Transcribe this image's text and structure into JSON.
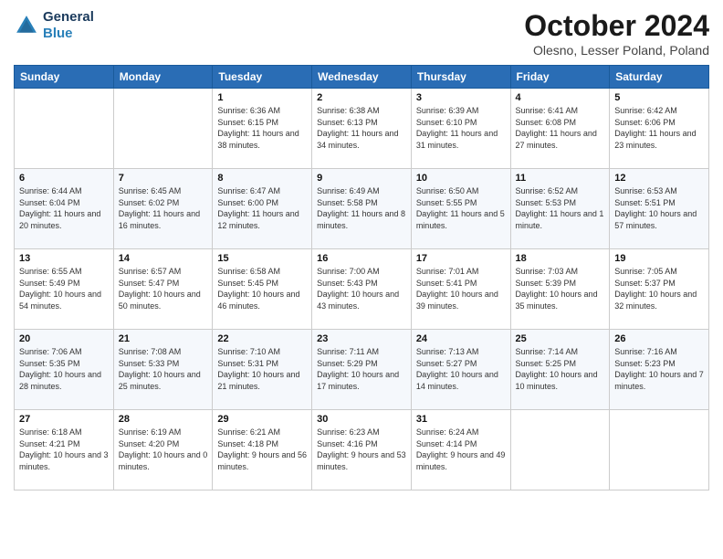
{
  "header": {
    "logo_line1": "General",
    "logo_line2": "Blue",
    "month_title": "October 2024",
    "location": "Olesno, Lesser Poland, Poland"
  },
  "days_of_week": [
    "Sunday",
    "Monday",
    "Tuesday",
    "Wednesday",
    "Thursday",
    "Friday",
    "Saturday"
  ],
  "weeks": [
    [
      {
        "day": "",
        "sunrise": "",
        "sunset": "",
        "daylight": ""
      },
      {
        "day": "",
        "sunrise": "",
        "sunset": "",
        "daylight": ""
      },
      {
        "day": "1",
        "sunrise": "Sunrise: 6:36 AM",
        "sunset": "Sunset: 6:15 PM",
        "daylight": "Daylight: 11 hours and 38 minutes."
      },
      {
        "day": "2",
        "sunrise": "Sunrise: 6:38 AM",
        "sunset": "Sunset: 6:13 PM",
        "daylight": "Daylight: 11 hours and 34 minutes."
      },
      {
        "day": "3",
        "sunrise": "Sunrise: 6:39 AM",
        "sunset": "Sunset: 6:10 PM",
        "daylight": "Daylight: 11 hours and 31 minutes."
      },
      {
        "day": "4",
        "sunrise": "Sunrise: 6:41 AM",
        "sunset": "Sunset: 6:08 PM",
        "daylight": "Daylight: 11 hours and 27 minutes."
      },
      {
        "day": "5",
        "sunrise": "Sunrise: 6:42 AM",
        "sunset": "Sunset: 6:06 PM",
        "daylight": "Daylight: 11 hours and 23 minutes."
      }
    ],
    [
      {
        "day": "6",
        "sunrise": "Sunrise: 6:44 AM",
        "sunset": "Sunset: 6:04 PM",
        "daylight": "Daylight: 11 hours and 20 minutes."
      },
      {
        "day": "7",
        "sunrise": "Sunrise: 6:45 AM",
        "sunset": "Sunset: 6:02 PM",
        "daylight": "Daylight: 11 hours and 16 minutes."
      },
      {
        "day": "8",
        "sunrise": "Sunrise: 6:47 AM",
        "sunset": "Sunset: 6:00 PM",
        "daylight": "Daylight: 11 hours and 12 minutes."
      },
      {
        "day": "9",
        "sunrise": "Sunrise: 6:49 AM",
        "sunset": "Sunset: 5:58 PM",
        "daylight": "Daylight: 11 hours and 8 minutes."
      },
      {
        "day": "10",
        "sunrise": "Sunrise: 6:50 AM",
        "sunset": "Sunset: 5:55 PM",
        "daylight": "Daylight: 11 hours and 5 minutes."
      },
      {
        "day": "11",
        "sunrise": "Sunrise: 6:52 AM",
        "sunset": "Sunset: 5:53 PM",
        "daylight": "Daylight: 11 hours and 1 minute."
      },
      {
        "day": "12",
        "sunrise": "Sunrise: 6:53 AM",
        "sunset": "Sunset: 5:51 PM",
        "daylight": "Daylight: 10 hours and 57 minutes."
      }
    ],
    [
      {
        "day": "13",
        "sunrise": "Sunrise: 6:55 AM",
        "sunset": "Sunset: 5:49 PM",
        "daylight": "Daylight: 10 hours and 54 minutes."
      },
      {
        "day": "14",
        "sunrise": "Sunrise: 6:57 AM",
        "sunset": "Sunset: 5:47 PM",
        "daylight": "Daylight: 10 hours and 50 minutes."
      },
      {
        "day": "15",
        "sunrise": "Sunrise: 6:58 AM",
        "sunset": "Sunset: 5:45 PM",
        "daylight": "Daylight: 10 hours and 46 minutes."
      },
      {
        "day": "16",
        "sunrise": "Sunrise: 7:00 AM",
        "sunset": "Sunset: 5:43 PM",
        "daylight": "Daylight: 10 hours and 43 minutes."
      },
      {
        "day": "17",
        "sunrise": "Sunrise: 7:01 AM",
        "sunset": "Sunset: 5:41 PM",
        "daylight": "Daylight: 10 hours and 39 minutes."
      },
      {
        "day": "18",
        "sunrise": "Sunrise: 7:03 AM",
        "sunset": "Sunset: 5:39 PM",
        "daylight": "Daylight: 10 hours and 35 minutes."
      },
      {
        "day": "19",
        "sunrise": "Sunrise: 7:05 AM",
        "sunset": "Sunset: 5:37 PM",
        "daylight": "Daylight: 10 hours and 32 minutes."
      }
    ],
    [
      {
        "day": "20",
        "sunrise": "Sunrise: 7:06 AM",
        "sunset": "Sunset: 5:35 PM",
        "daylight": "Daylight: 10 hours and 28 minutes."
      },
      {
        "day": "21",
        "sunrise": "Sunrise: 7:08 AM",
        "sunset": "Sunset: 5:33 PM",
        "daylight": "Daylight: 10 hours and 25 minutes."
      },
      {
        "day": "22",
        "sunrise": "Sunrise: 7:10 AM",
        "sunset": "Sunset: 5:31 PM",
        "daylight": "Daylight: 10 hours and 21 minutes."
      },
      {
        "day": "23",
        "sunrise": "Sunrise: 7:11 AM",
        "sunset": "Sunset: 5:29 PM",
        "daylight": "Daylight: 10 hours and 17 minutes."
      },
      {
        "day": "24",
        "sunrise": "Sunrise: 7:13 AM",
        "sunset": "Sunset: 5:27 PM",
        "daylight": "Daylight: 10 hours and 14 minutes."
      },
      {
        "day": "25",
        "sunrise": "Sunrise: 7:14 AM",
        "sunset": "Sunset: 5:25 PM",
        "daylight": "Daylight: 10 hours and 10 minutes."
      },
      {
        "day": "26",
        "sunrise": "Sunrise: 7:16 AM",
        "sunset": "Sunset: 5:23 PM",
        "daylight": "Daylight: 10 hours and 7 minutes."
      }
    ],
    [
      {
        "day": "27",
        "sunrise": "Sunrise: 6:18 AM",
        "sunset": "Sunset: 4:21 PM",
        "daylight": "Daylight: 10 hours and 3 minutes."
      },
      {
        "day": "28",
        "sunrise": "Sunrise: 6:19 AM",
        "sunset": "Sunset: 4:20 PM",
        "daylight": "Daylight: 10 hours and 0 minutes."
      },
      {
        "day": "29",
        "sunrise": "Sunrise: 6:21 AM",
        "sunset": "Sunset: 4:18 PM",
        "daylight": "Daylight: 9 hours and 56 minutes."
      },
      {
        "day": "30",
        "sunrise": "Sunrise: 6:23 AM",
        "sunset": "Sunset: 4:16 PM",
        "daylight": "Daylight: 9 hours and 53 minutes."
      },
      {
        "day": "31",
        "sunrise": "Sunrise: 6:24 AM",
        "sunset": "Sunset: 4:14 PM",
        "daylight": "Daylight: 9 hours and 49 minutes."
      },
      {
        "day": "",
        "sunrise": "",
        "sunset": "",
        "daylight": ""
      },
      {
        "day": "",
        "sunrise": "",
        "sunset": "",
        "daylight": ""
      }
    ]
  ]
}
